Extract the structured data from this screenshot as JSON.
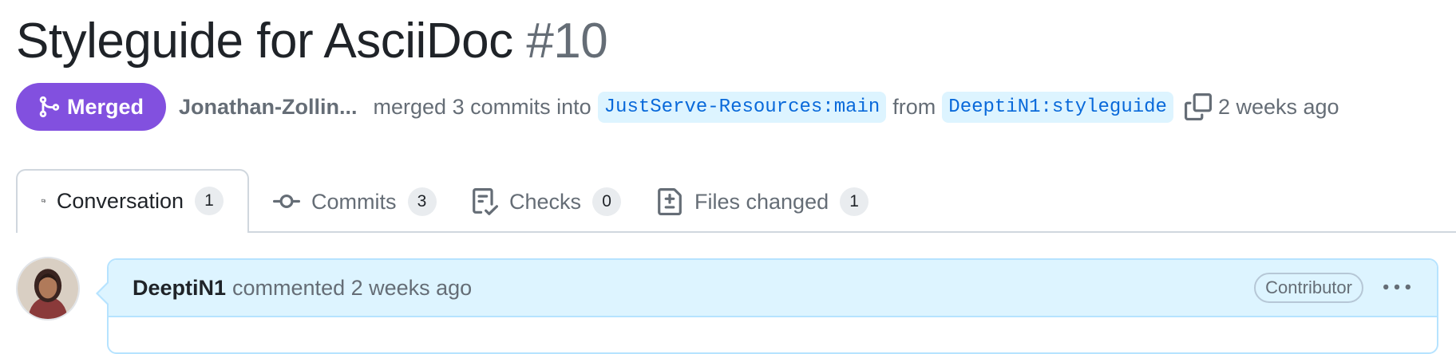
{
  "pr": {
    "title": "Styleguide for AsciiDoc",
    "number": "#10",
    "state": "Merged",
    "author": "Jonathan-Zollin...",
    "merged_text": "merged 3 commits into",
    "base_branch": "JustServe-Resources:main",
    "from_text": "from",
    "head_branch": "DeeptiN1:styleguide",
    "time": "2 weeks ago"
  },
  "tabs": [
    {
      "label": "Conversation",
      "count": "1",
      "icon": "comment-discussion-icon"
    },
    {
      "label": "Commits",
      "count": "3",
      "icon": "git-commit-icon"
    },
    {
      "label": "Checks",
      "count": "0",
      "icon": "checklist-icon"
    },
    {
      "label": "Files changed",
      "count": "1",
      "icon": "file-diff-icon"
    }
  ],
  "comment": {
    "author": "DeeptiN1",
    "text": "commented 2 weeks ago",
    "role": "Contributor",
    "menu_icon": "kebab-horizontal-icon"
  },
  "colors": {
    "merged": "#8250df",
    "link": "#0969da",
    "branch_bg": "#ddf4ff",
    "comment_header_bg": "#ddf4ff"
  }
}
